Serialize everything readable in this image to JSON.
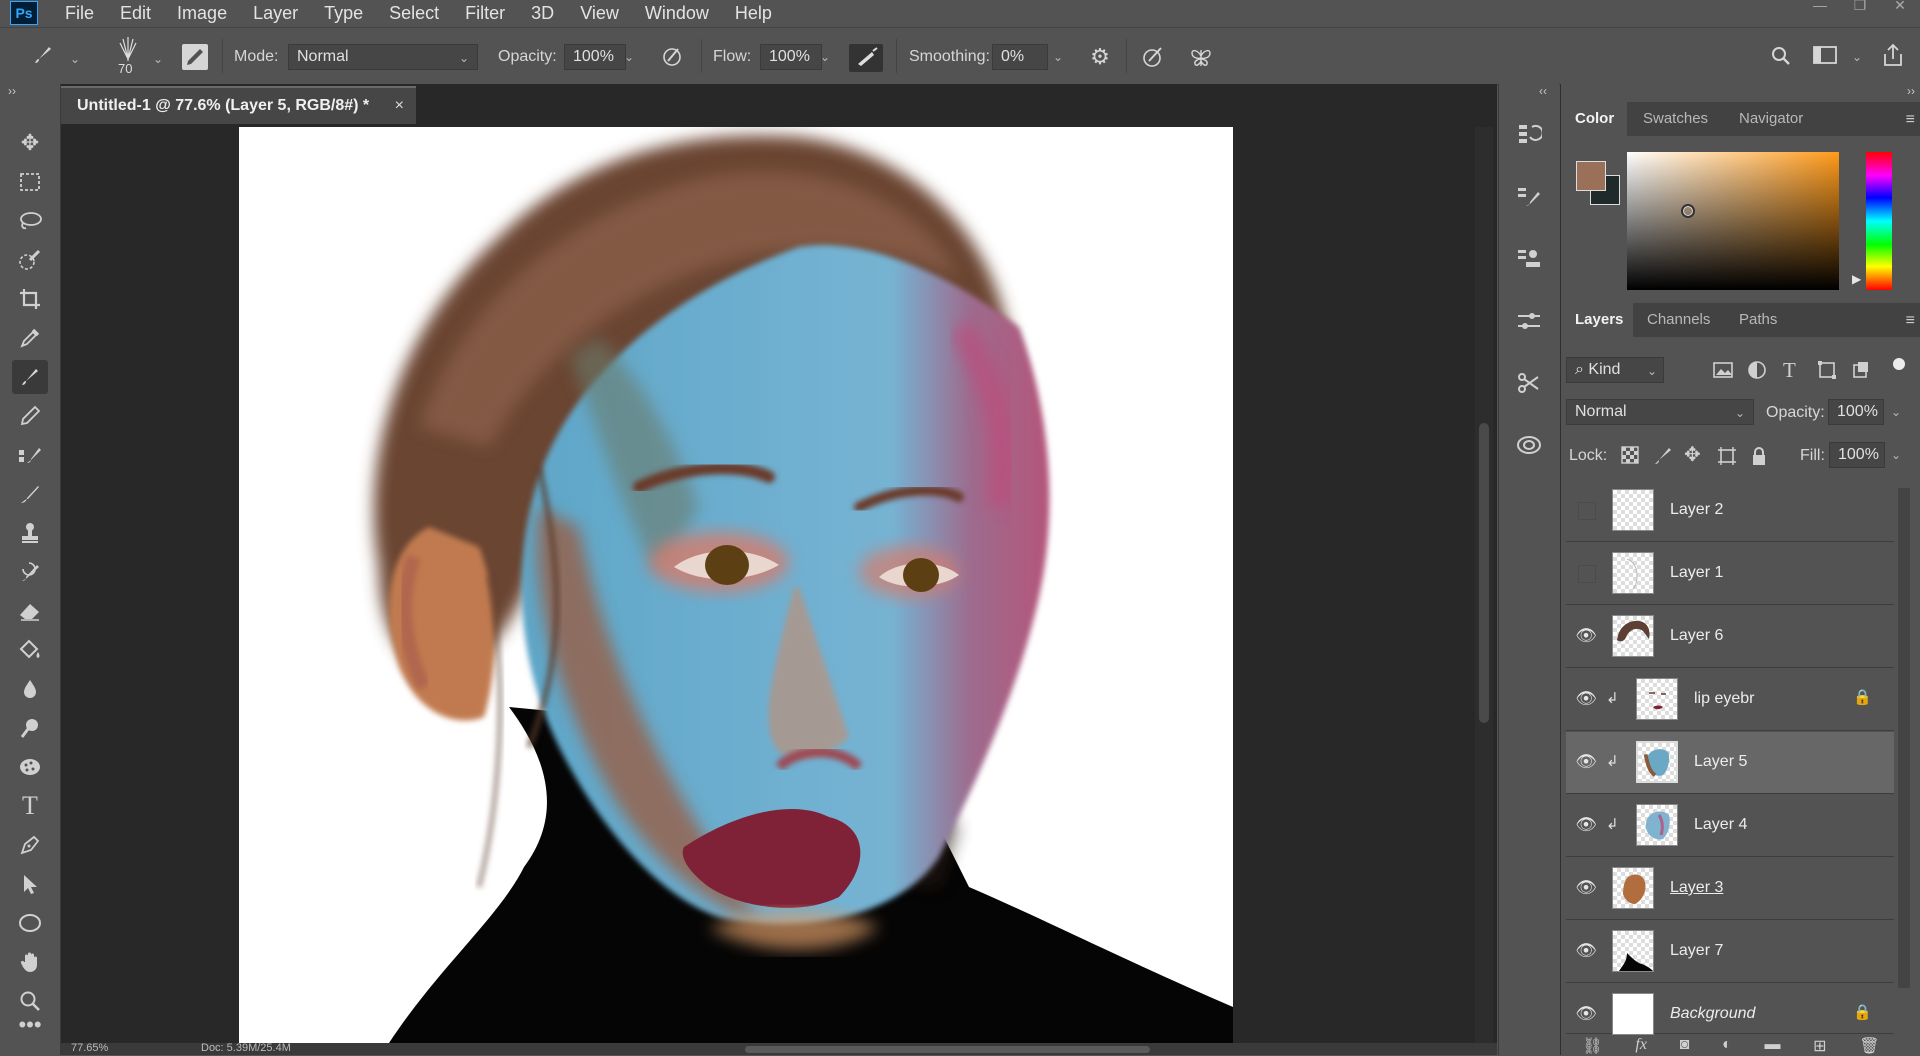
{
  "app": {
    "logo": "Ps"
  },
  "menu": [
    "File",
    "Edit",
    "Image",
    "Layer",
    "Type",
    "Select",
    "Filter",
    "3D",
    "View",
    "Window",
    "Help"
  ],
  "window_controls": {
    "minimize": "—",
    "restore": "❐",
    "close": "✕"
  },
  "options": {
    "brush_size": "70",
    "mode_label": "Mode:",
    "mode_value": "Normal",
    "opacity_label": "Opacity:",
    "opacity_value": "100%",
    "flow_label": "Flow:",
    "flow_value": "100%",
    "smoothing_label": "Smoothing:",
    "smoothing_value": "0%"
  },
  "document": {
    "tab_title": "Untitled-1 @ 77.6% (Layer 5, RGB/8#) *",
    "close": "×",
    "zoom": "77.65%",
    "doc_info": "Doc: 5.39M/25.4M"
  },
  "color_panel": {
    "tabs": [
      "Color",
      "Swatches",
      "Navigator"
    ],
    "active_tab": "Color",
    "foreground": "#9a7158",
    "background": "#1f2b2a",
    "hue_base": "#ff9a1a"
  },
  "layers_panel": {
    "tabs": [
      "Layers",
      "Channels",
      "Paths"
    ],
    "filter_kind": "Kind",
    "blend_mode": "Normal",
    "opacity_label": "Opacity:",
    "opacity_value": "100%",
    "lock_label": "Lock:",
    "fill_label": "Fill:",
    "fill_value": "100%",
    "layers": [
      {
        "name": "Layer 2",
        "visible": false,
        "clipped": false,
        "locked": false,
        "selected": false,
        "underline": false,
        "italic": false
      },
      {
        "name": "Layer 1",
        "visible": false,
        "clipped": false,
        "locked": false,
        "selected": false,
        "underline": false,
        "italic": false
      },
      {
        "name": "Layer 6",
        "visible": true,
        "clipped": false,
        "locked": false,
        "selected": false,
        "underline": false,
        "italic": false
      },
      {
        "name": "lip eyebr",
        "visible": true,
        "clipped": true,
        "locked": true,
        "selected": false,
        "underline": false,
        "italic": false
      },
      {
        "name": "Layer 5",
        "visible": true,
        "clipped": true,
        "locked": false,
        "selected": true,
        "underline": false,
        "italic": false
      },
      {
        "name": "Layer 4",
        "visible": true,
        "clipped": true,
        "locked": false,
        "selected": false,
        "underline": false,
        "italic": false
      },
      {
        "name": "Layer 3",
        "visible": true,
        "clipped": false,
        "locked": false,
        "selected": false,
        "underline": true,
        "italic": false
      },
      {
        "name": "Layer 7",
        "visible": true,
        "clipped": false,
        "locked": false,
        "selected": false,
        "underline": false,
        "italic": false
      },
      {
        "name": "Background",
        "visible": true,
        "clipped": false,
        "locked": true,
        "selected": false,
        "underline": false,
        "italic": true
      }
    ],
    "footer_icons": [
      "link-icon",
      "fx-icon",
      "mask-icon",
      "adjustment-icon",
      "group-icon",
      "new-layer-icon",
      "trash-icon"
    ],
    "footer_fx": "fx"
  }
}
